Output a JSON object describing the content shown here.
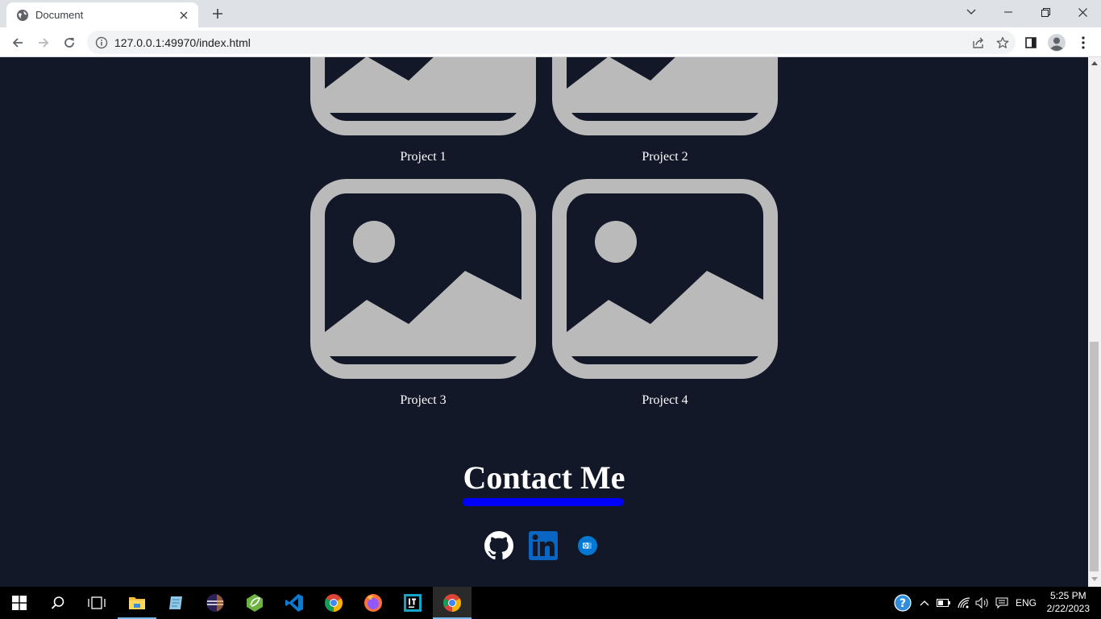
{
  "browser": {
    "tab_title": "Document",
    "url": "127.0.0.1:49970/index.html"
  },
  "page": {
    "projects": [
      {
        "label": "Project 1"
      },
      {
        "label": "Project 2"
      },
      {
        "label": "Project 3"
      },
      {
        "label": "Project 4"
      }
    ],
    "contact_title": "Contact Me",
    "socials": [
      {
        "icon": "github-icon"
      },
      {
        "icon": "linkedin-icon"
      },
      {
        "icon": "outlook-icon"
      }
    ],
    "colors": {
      "background": "#131829",
      "placeholder": "#bababa",
      "underline": "#0000ff",
      "text": "#ffffff"
    }
  },
  "taskbar": {
    "apps": [
      "windows-start-icon",
      "search-icon",
      "task-view-icon",
      "file-explorer-icon",
      "notepad-icon",
      "eclipse-icon",
      "spring-tools-icon",
      "vscode-icon",
      "chrome-icon",
      "firefox-icon",
      "intellij-icon",
      "chrome-icon"
    ],
    "language": "ENG",
    "time": "5:25 PM",
    "date": "2/22/2023"
  }
}
